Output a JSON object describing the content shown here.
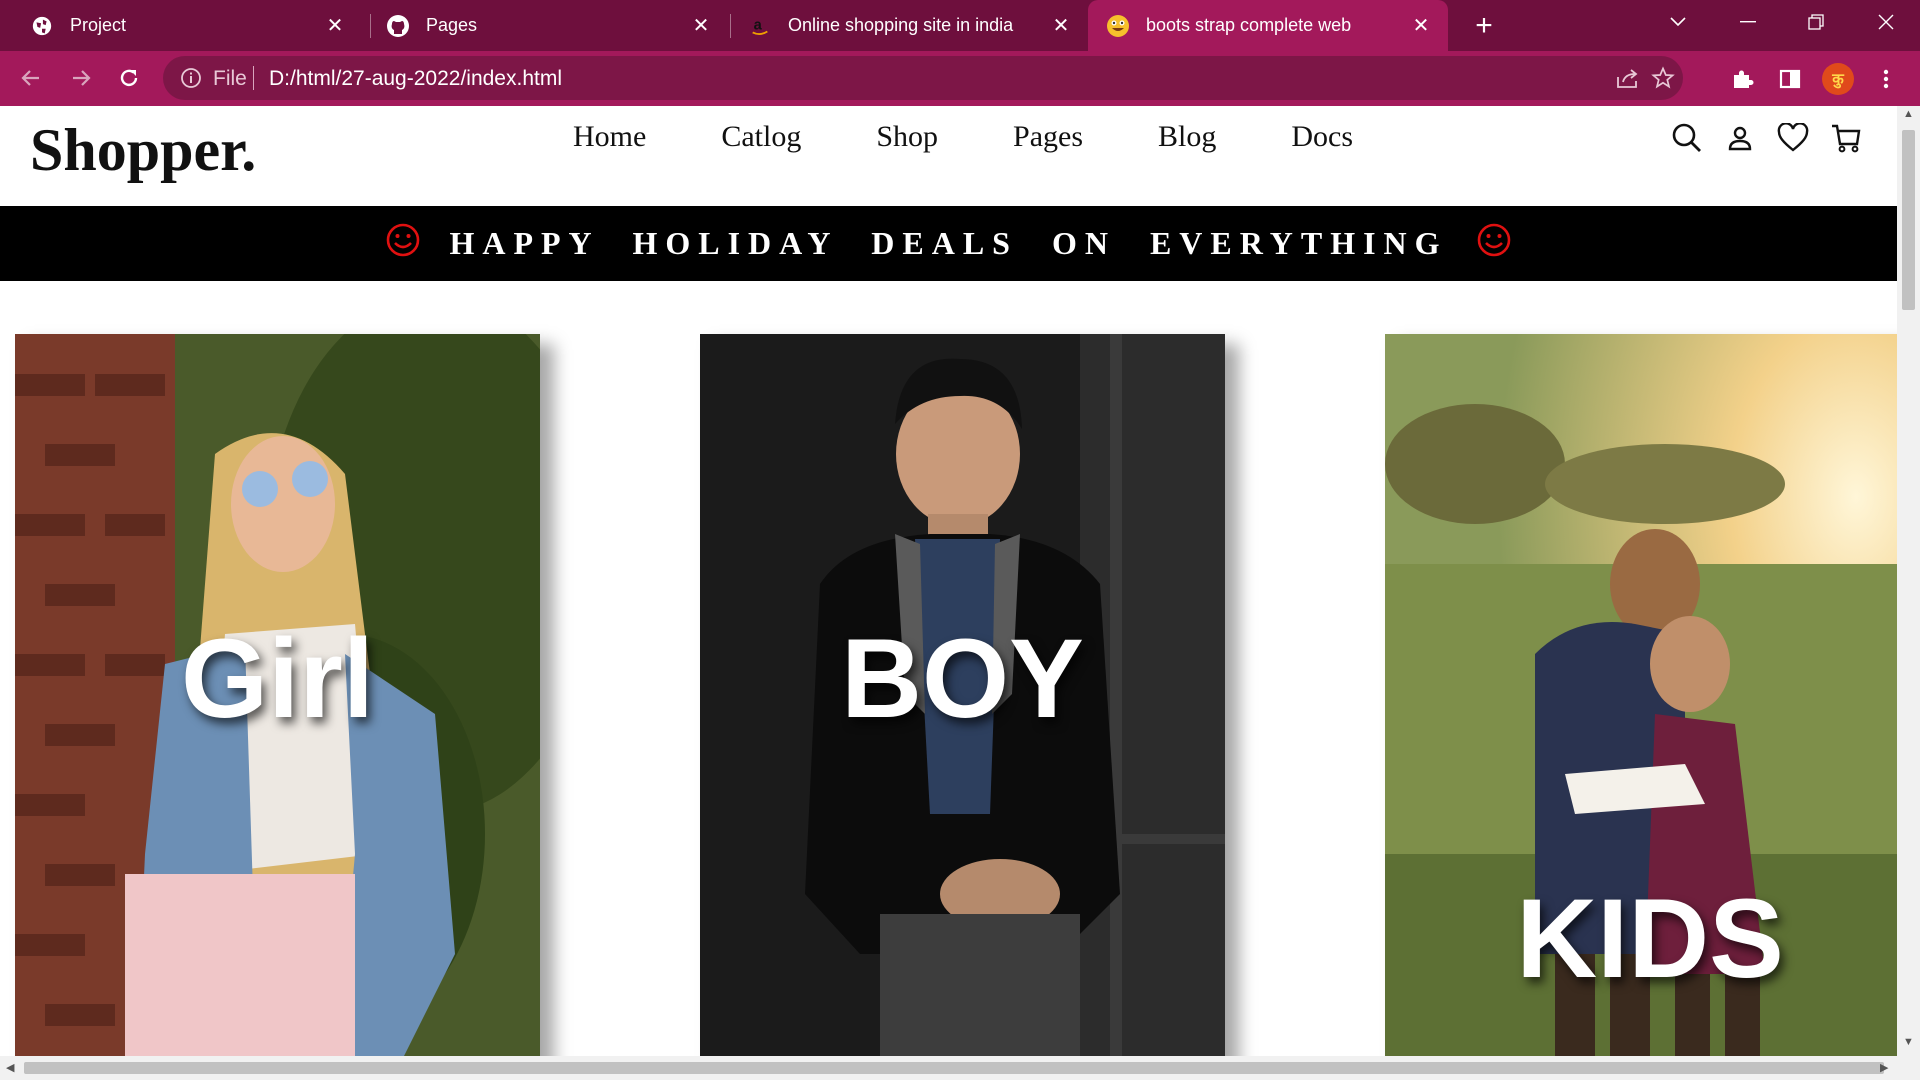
{
  "browser": {
    "tabs": [
      {
        "title": "Project",
        "icon": "globe-icon"
      },
      {
        "title": "Pages",
        "icon": "github-icon"
      },
      {
        "title": "Online shopping site in india",
        "icon": "amazon-icon"
      },
      {
        "title": "boots strap complete web",
        "icon": "emoji-face-icon",
        "active": true
      }
    ],
    "address": {
      "scheme_label": "File",
      "url": "D:/html/27-aug-2022/index.html"
    },
    "colors": {
      "frame": "#6e0f3d",
      "toolbar": "#a3195b",
      "omnibox": "#7d1647"
    },
    "profile_badge": "कु"
  },
  "site": {
    "brand": "Shopper.",
    "nav": [
      "Home",
      "Catlog",
      "Shop",
      "Pages",
      "Blog",
      "Docs"
    ],
    "header_icons": [
      "search-icon",
      "user-icon",
      "heart-icon",
      "cart-icon"
    ],
    "banner": {
      "text": "HAPPY HOLIDAY DEALS ON EVERYTHING",
      "icon": "smiley-icon",
      "icon_color": "#e01010"
    },
    "cards": [
      {
        "label": "Girl"
      },
      {
        "label": "BOY"
      },
      {
        "label": "KIDS"
      }
    ]
  }
}
